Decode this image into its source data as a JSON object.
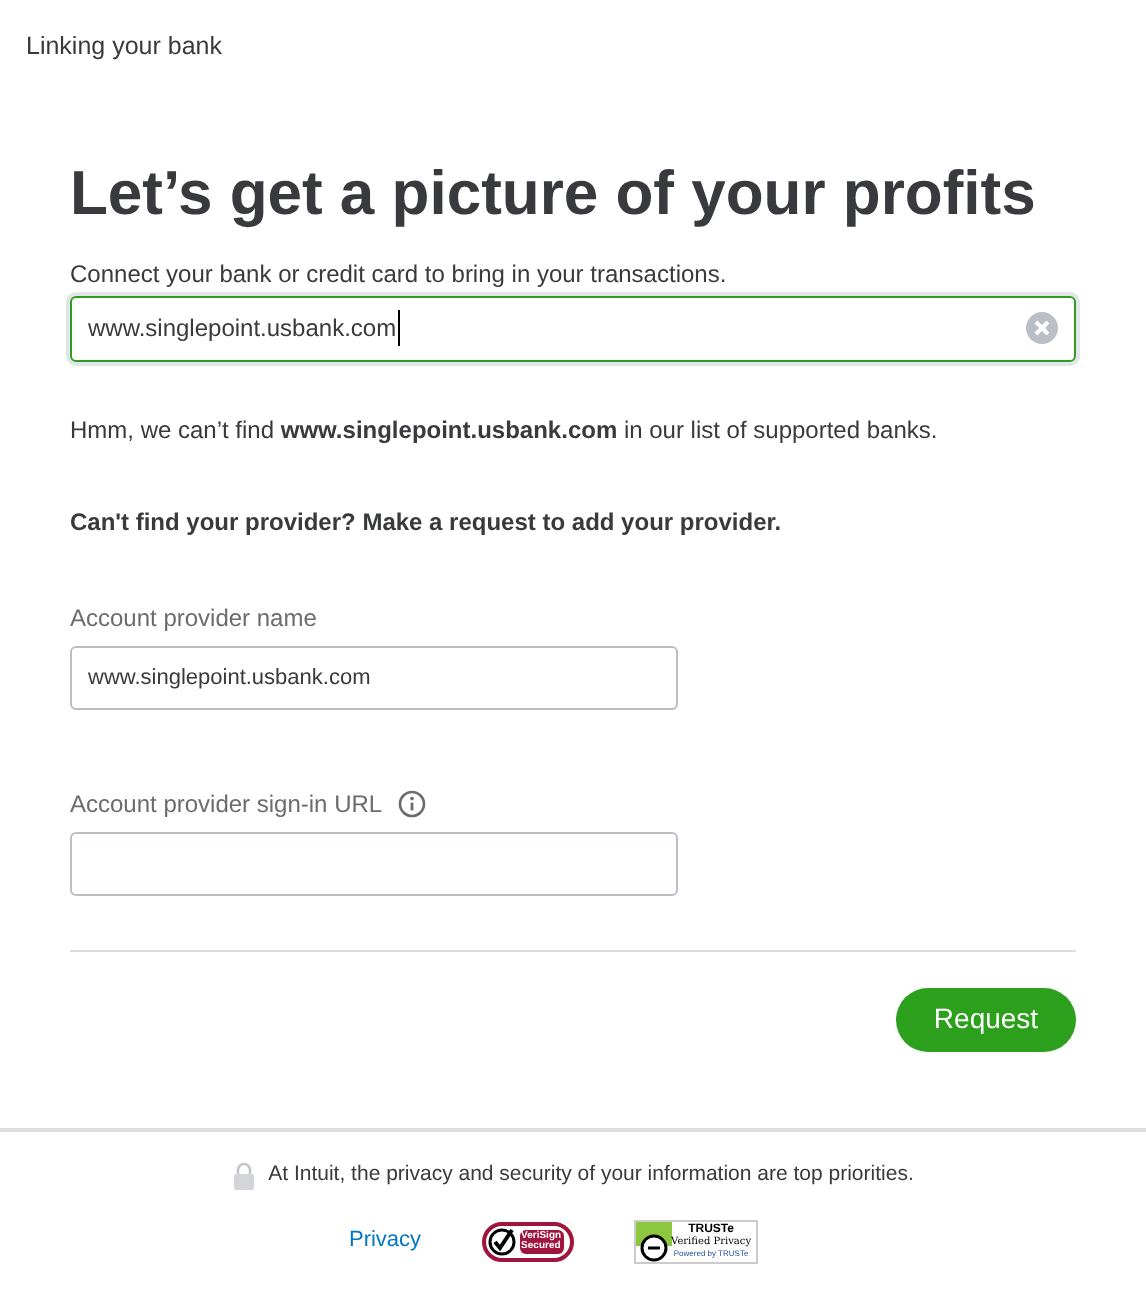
{
  "header": {
    "title": "Linking your bank"
  },
  "heading": "Let’s get a picture of your profits",
  "search": {
    "label": "Connect your bank or credit card to bring in your transactions.",
    "value": "www.singlepoint.usbank.com",
    "focused": true
  },
  "not_found_message": "Hmm, we can’t find **www.singlepoint.usbank.com** in our list of supported banks.",
  "request_prompt": "Can't find your provider? Make a request to add your provider.",
  "fields": [
    {
      "label": "Account provider name",
      "value": "www.singlepoint.usbank.com",
      "info": false
    },
    {
      "label": "Account provider sign-in URL",
      "info": true
    }
  ],
  "request_button": "Request",
  "footer": {
    "security_note": "At Intuit, the privacy and security of your information are top priorities.",
    "privacy_link": "Privacy",
    "verisign_badge": {
      "text": "VeriSign Secured"
    },
    "truste_badge": {
      "title": "TRUSTe",
      "subtitle": "Verified Privacy",
      "powered": "Powered by TRUSTe"
    }
  }
}
